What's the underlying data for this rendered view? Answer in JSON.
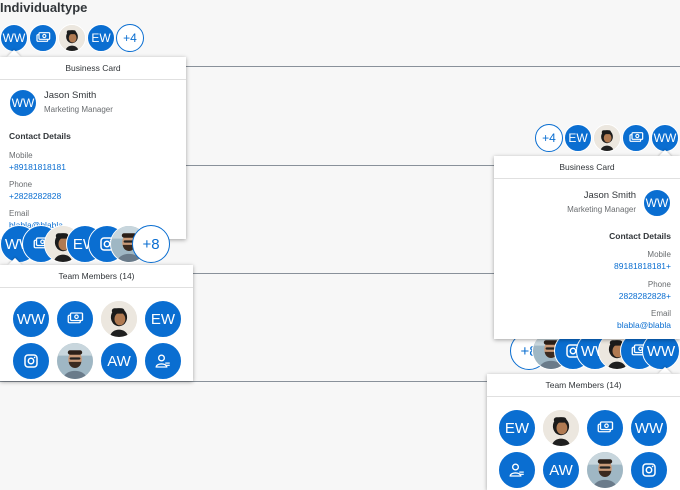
{
  "page": {
    "title": "Individualtype"
  },
  "left_group": {
    "avatars": [
      {
        "initials": "WW",
        "icon": ""
      },
      {
        "initials": "",
        "icon": "money-bills-icon"
      },
      {
        "initials": "",
        "icon": "person-photo"
      },
      {
        "initials": "EW",
        "icon": ""
      }
    ],
    "overflow": "+4"
  },
  "right_group": {
    "overflow": "+4",
    "avatars": [
      {
        "initials": "EW",
        "icon": ""
      },
      {
        "initials": "",
        "icon": "person-photo"
      },
      {
        "initials": "",
        "icon": "money-bills-icon"
      },
      {
        "initials": "WW",
        "icon": ""
      }
    ]
  },
  "business_card": {
    "header": "Business Card",
    "avatar_initials": "WW",
    "name": "Jason Smith",
    "role": "Marketing Manager",
    "contact_title": "Contact Details",
    "mobile_label": "Mobile",
    "phone_label": "Phone",
    "email_label": "Email",
    "email": "blabla@blabla",
    "phone": "+2828282828"
  },
  "business_card_left": {
    "mobile": "+89181818181"
  },
  "business_card_right": {
    "mobile": "89181818181+",
    "phone": "2828282828+"
  },
  "left_group_2": {
    "overflow": "+8",
    "initials_1": "WW",
    "initials_2": "EW"
  },
  "right_group_2": {
    "overflow": "+8",
    "initials_1": "WW"
  },
  "team_members": {
    "header": "Team Members (14)",
    "left_grid": [
      "WW",
      "money-bills-icon",
      "person-photo",
      "EW",
      "instagram-icon",
      "man-photo",
      "AW",
      "employee-icon"
    ],
    "right_grid": [
      "EW",
      "person-photo",
      "money-bills-icon",
      "WW",
      "employee-icon",
      "AW",
      "man-photo",
      "instagram-icon"
    ]
  },
  "colors": {
    "accent": "#0a6ed1",
    "background": "#f7f7f7"
  }
}
